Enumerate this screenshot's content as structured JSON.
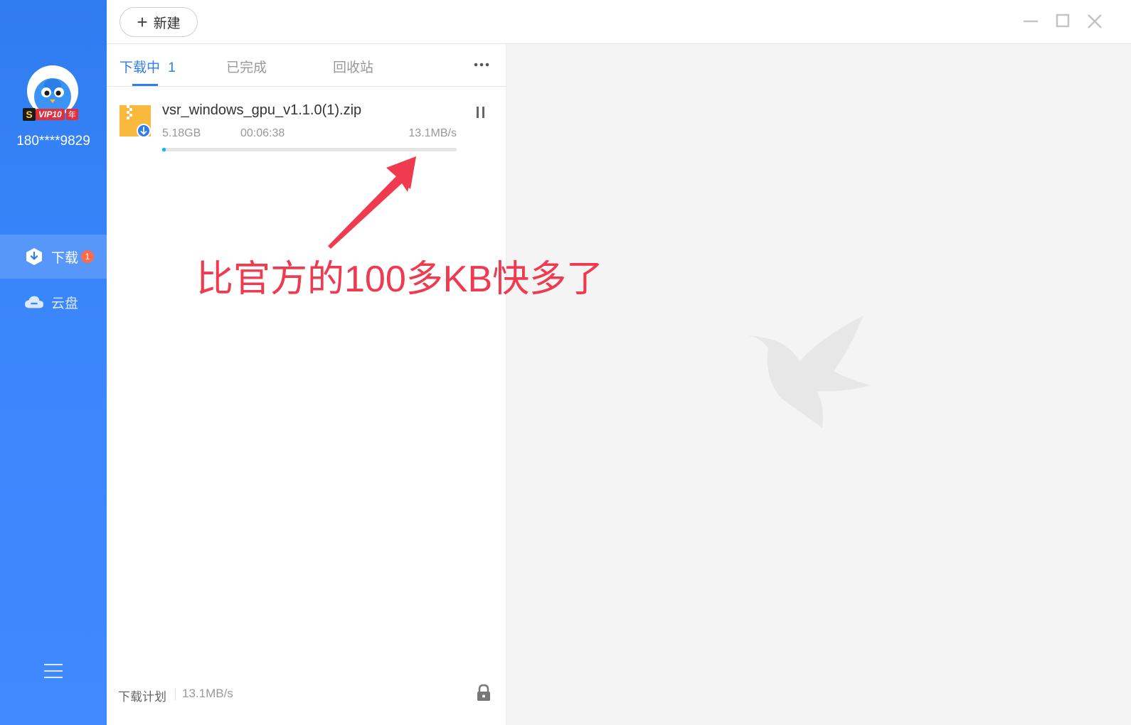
{
  "topbar": {
    "new_button_label": "新建"
  },
  "user": {
    "vip_badge_text": "VIP10",
    "vip_year_text": "年",
    "phone": "180****9829"
  },
  "nav": {
    "download_label": "下载",
    "download_badge": "1",
    "cloud_label": "云盘"
  },
  "tabs": {
    "downloading_label": "下载中",
    "downloading_count": "1",
    "completed_label": "已完成",
    "recycle_label": "回收站"
  },
  "task": {
    "file_name": "vsr_windows_gpu_v1.1.0(1).zip",
    "size": "5.18GB",
    "time_remaining": "00:06:38",
    "speed": "13.1MB/s",
    "progress_fraction": 0.012
  },
  "footer": {
    "plan_label": "下载计划",
    "speed": "13.1MB/s"
  },
  "annotation": {
    "text": "比官方的100多KB快多了",
    "color": "#f03a4f"
  },
  "colors": {
    "accent": "#2f7bf0",
    "progress": "#12b6f0",
    "badge": "#ff6a4a"
  }
}
